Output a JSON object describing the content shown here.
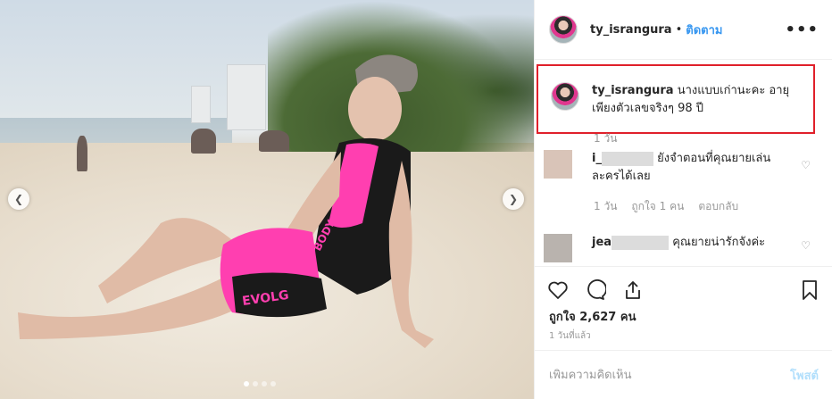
{
  "post": {
    "dots_count": 4,
    "active_dot": 0
  },
  "header": {
    "username": "ty_israngura",
    "separator": "•",
    "follow_label": "ติดตาม",
    "more_label": "•••"
  },
  "caption": {
    "username": "ty_israngura",
    "text": "นางแบบเก่านะคะ อายุเพียงตัวเลขจริงๆ 98 ปี",
    "time": "1 วัน"
  },
  "comments": [
    {
      "user_visible": "i_",
      "text": "ยังจำตอนที่คุณยายเล่นละครได้เลย",
      "time": "1 วัน",
      "likes": "ถูกใจ 1 คน",
      "reply": "ตอบกลับ"
    },
    {
      "user_visible": "jea",
      "text": "คุณยายน่ารักจังค่ะ"
    }
  ],
  "likes_text": "ถูกใจ 2,627 คน",
  "time_ago": "1 วันที่แล้ว",
  "add_comment": {
    "placeholder": "เพิ่มความคิดเห็น",
    "post_label": "โพสต์"
  },
  "colors": {
    "accent": "#3897f0",
    "highlight_border": "#e0202a",
    "post_disabled": "#b2dffc",
    "swimsuit_pink": "#ff3fb0"
  }
}
